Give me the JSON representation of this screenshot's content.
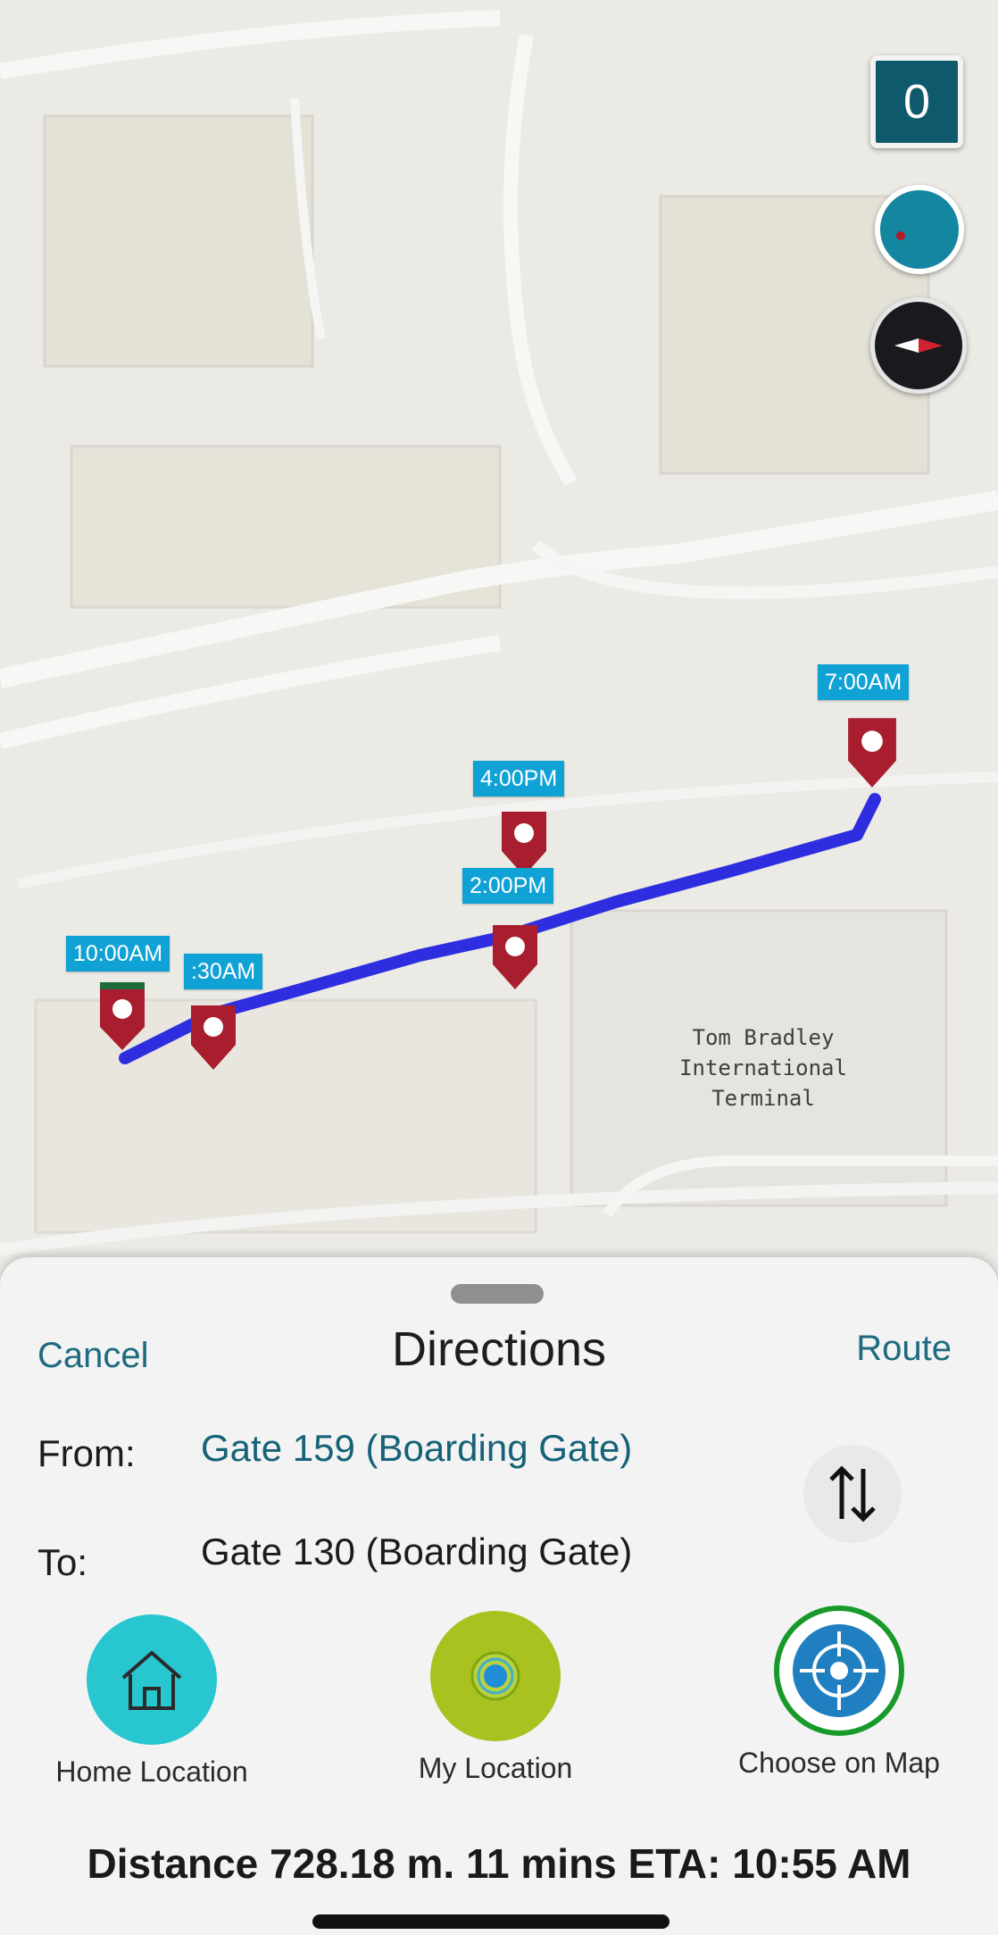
{
  "map": {
    "floor_level": "0",
    "terminal_label": [
      "Tom Bradley",
      "International",
      "Terminal"
    ],
    "route_color": "#2e2ee0",
    "pin_color": "#a81e2e",
    "label_color": "#10a2d4",
    "time_labels": [
      "7:00AM",
      "4:00PM",
      "2:00PM",
      "10:00AM",
      ":30AM"
    ]
  },
  "sheet": {
    "title": "Directions",
    "cancel_label": "Cancel",
    "route_label": "Route",
    "from_label": "From:",
    "from_value": "Gate 159 (Boarding Gate)",
    "to_label": "To:",
    "to_value": "Gate 130 (Boarding Gate)",
    "quick_actions": [
      {
        "label": "Home Location",
        "icon": "home-icon",
        "color": "#28c6cf"
      },
      {
        "label": "My Location",
        "icon": "my-location-icon",
        "color": "#a9c21f"
      },
      {
        "label": "Choose on Map",
        "icon": "crosshair-icon",
        "color": "#1f7fc0"
      }
    ],
    "summary": "Distance 728.18 m. 11 mins ETA: 10:55 AM"
  }
}
